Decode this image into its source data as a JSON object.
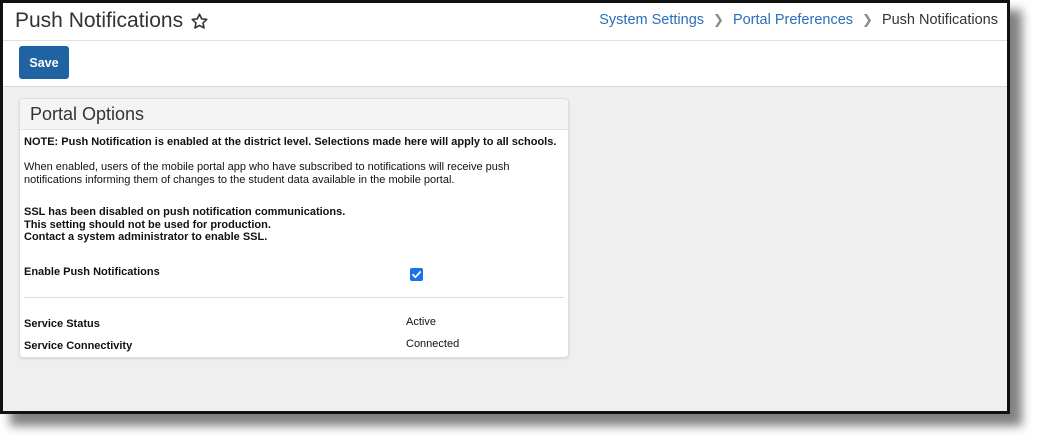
{
  "page": {
    "title": "Push Notifications",
    "favorite_icon": "star-outline-icon"
  },
  "breadcrumb": {
    "items": [
      {
        "label": "System Settings"
      },
      {
        "label": "Portal Preferences"
      },
      {
        "label": "Push Notifications"
      }
    ],
    "separator_icon": "chevron-right-icon"
  },
  "toolbar": {
    "save_label": "Save",
    "save_color": "#1f63a3"
  },
  "panel": {
    "title": "Portal Options",
    "note": "NOTE: Push Notification is enabled at the district level. Selections made here will apply to all schools.",
    "description": "When enabled, users of the mobile portal app who have subscribed to notifications will receive push notifications informing them of changes to the student data available in the mobile portal.",
    "ssl_lines": [
      "SSL has been disabled on push notification communications.",
      "This setting should not be used for production.",
      "Contact a system administrator to enable SSL."
    ],
    "enable_label": "Enable Push Notifications",
    "enable_checked": true,
    "service_status_label": "Service Status",
    "service_status_value": "Active",
    "service_connectivity_label": "Service Connectivity",
    "service_connectivity_value": "Connected"
  },
  "colors": {
    "link": "#2a6ebb",
    "checkbox": "#1a73e8",
    "background": "#efefef"
  }
}
